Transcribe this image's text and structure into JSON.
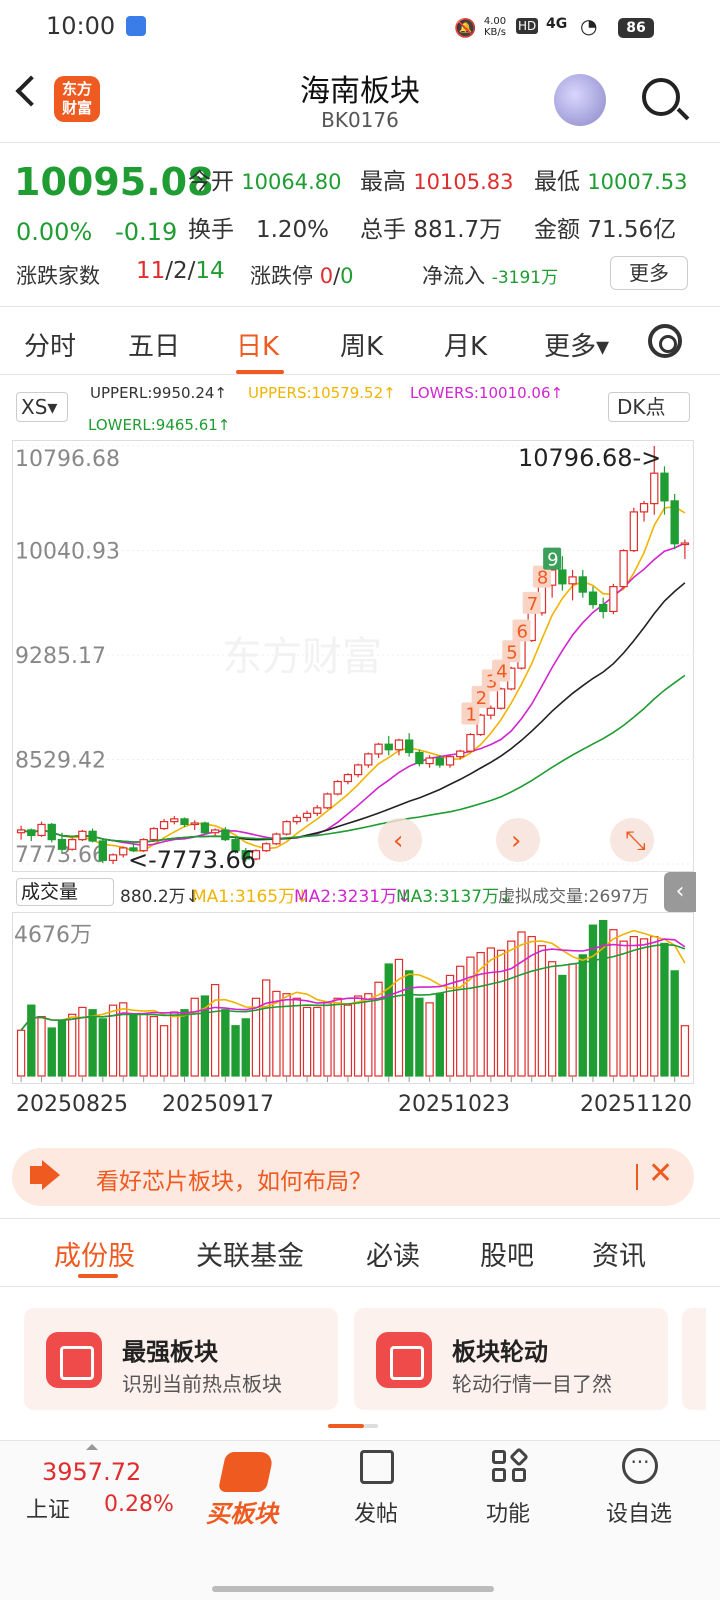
{
  "status_bar": {
    "time": "10:00",
    "net_speed": "4.00 KB/s",
    "signal": "4G",
    "battery": "86"
  },
  "header": {
    "title": "海南板块",
    "code": "BK0176",
    "logo_text": "东方财富"
  },
  "quote": {
    "price": "10095.08",
    "change_pct": "0.00%",
    "change": "-0.19",
    "open_label": "今开",
    "open": "10064.80",
    "high_label": "最高",
    "high": "10105.83",
    "low_label": "最低",
    "low": "10007.53",
    "turnover_label": "换手",
    "turnover": "1.20%",
    "volume_label": "总手",
    "volume": "881.7万",
    "amount_label": "金额",
    "amount": "71.56亿",
    "breadth_label": "涨跌家数",
    "breadth_up": "11",
    "breadth_flat": "/2/",
    "breadth_down": "14",
    "limit_label": "涨跌停",
    "limit_up": "0",
    "limit_sep": "/",
    "limit_down": "0",
    "netflow_label": "净流入",
    "netflow": "-3191万",
    "more": "更多"
  },
  "period_tabs": [
    "分时",
    "五日",
    "日K",
    "周K",
    "月K",
    "更多▾"
  ],
  "active_period": "日K",
  "indicators": {
    "selector": "XS▾",
    "upperl": "UPPERL:9950.24↑",
    "uppers": "UPPERS:10579.52↑",
    "lowers": "LOWERS:10010.06↑",
    "lowerl": "LOWERL:9465.61↑",
    "dk_button": "DK点"
  },
  "colors": {
    "up": "#e02d2d",
    "down": "#1f9c32",
    "accent": "#ef5a20",
    "ma1": "#f0b400",
    "ma2": "#d025d0",
    "ma3": "#1f9c32"
  },
  "chart_data": [
    {
      "type": "candlestick",
      "y_axis_labels": [
        "10796.68",
        "10040.93",
        "9285.17",
        "8529.42",
        "7773.66"
      ],
      "ylim": [
        7773.66,
        10796.68
      ],
      "max_annotation": "10796.68->",
      "min_annotation": "<-7773.66",
      "watermark": "东方财富",
      "x_tick_labels": [
        "20250825",
        "20250917",
        "20251023",
        "20251120"
      ],
      "candles": [
        [
          8000,
          8050,
          7950,
          8020
        ],
        [
          8020,
          8030,
          7940,
          7980
        ],
        [
          7980,
          8080,
          7970,
          8060
        ],
        [
          8060,
          8070,
          7930,
          7950
        ],
        [
          7950,
          8000,
          7850,
          7880
        ],
        [
          7880,
          7960,
          7870,
          7950
        ],
        [
          7950,
          8020,
          7940,
          8010
        ],
        [
          8010,
          8030,
          7930,
          7940
        ],
        [
          7940,
          7960,
          7780,
          7800
        ],
        [
          7800,
          7850,
          7774,
          7840
        ],
        [
          7840,
          7900,
          7820,
          7890
        ],
        [
          7890,
          7920,
          7860,
          7870
        ],
        [
          7870,
          7960,
          7860,
          7950
        ],
        [
          7950,
          8040,
          7940,
          8030
        ],
        [
          8030,
          8100,
          8020,
          8080
        ],
        [
          8080,
          8120,
          8060,
          8100
        ],
        [
          8100,
          8110,
          8040,
          8060
        ],
        [
          8060,
          8090,
          8020,
          8070
        ],
        [
          8070,
          8080,
          7990,
          8000
        ],
        [
          8000,
          8030,
          7980,
          8020
        ],
        [
          8020,
          8040,
          7940,
          7950
        ],
        [
          7950,
          7960,
          7850,
          7870
        ],
        [
          7870,
          7890,
          7790,
          7810
        ],
        [
          7810,
          7880,
          7800,
          7870
        ],
        [
          7870,
          7930,
          7860,
          7920
        ],
        [
          7920,
          8000,
          7910,
          7990
        ],
        [
          7990,
          8090,
          7980,
          8080
        ],
        [
          8080,
          8130,
          8060,
          8110
        ],
        [
          8110,
          8160,
          8080,
          8140
        ],
        [
          8140,
          8200,
          8120,
          8180
        ],
        [
          8180,
          8290,
          8170,
          8280
        ],
        [
          8280,
          8380,
          8270,
          8370
        ],
        [
          8370,
          8430,
          8350,
          8420
        ],
        [
          8420,
          8500,
          8400,
          8490
        ],
        [
          8490,
          8580,
          8470,
          8570
        ],
        [
          8570,
          8650,
          8540,
          8640
        ],
        [
          8640,
          8700,
          8560,
          8600
        ],
        [
          8600,
          8680,
          8560,
          8670
        ],
        [
          8670,
          8720,
          8550,
          8580
        ],
        [
          8580,
          8600,
          8480,
          8500
        ],
        [
          8500,
          8560,
          8470,
          8540
        ],
        [
          8540,
          8560,
          8470,
          8490
        ],
        [
          8490,
          8560,
          8470,
          8550
        ],
        [
          8550,
          8600,
          8530,
          8590
        ],
        [
          8590,
          8720,
          8580,
          8710
        ],
        [
          8710,
          8860,
          8700,
          8850
        ],
        [
          8850,
          8920,
          8820,
          8900
        ],
        [
          8900,
          9050,
          8890,
          9040
        ],
        [
          9040,
          9200,
          9030,
          9190
        ],
        [
          9190,
          9400,
          9180,
          9390
        ],
        [
          9390,
          9600,
          9380,
          9590
        ],
        [
          9590,
          9800,
          9570,
          9790
        ],
        [
          9790,
          9950,
          9700,
          9900
        ],
        [
          9900,
          10000,
          9750,
          9800
        ],
        [
          9800,
          9900,
          9680,
          9850
        ],
        [
          9850,
          9900,
          9700,
          9740
        ],
        [
          9740,
          9780,
          9620,
          9650
        ],
        [
          9650,
          9700,
          9550,
          9600
        ],
        [
          9600,
          9800,
          9580,
          9780
        ],
        [
          9780,
          10050,
          9770,
          10040
        ],
        [
          10040,
          10350,
          10030,
          10320
        ],
        [
          10320,
          10400,
          10250,
          10380
        ],
        [
          10380,
          10797,
          10300,
          10600
        ],
        [
          10600,
          10650,
          10300,
          10400
        ],
        [
          10400,
          10450,
          10050,
          10090
        ],
        [
          10090,
          10120,
          9980,
          10095
        ]
      ],
      "nine_turn_labels": [
        "1",
        "2",
        "3",
        "4",
        "5",
        "6",
        "7",
        "8",
        "9"
      ]
    },
    {
      "type": "bar",
      "title": "成交量",
      "y_axis_labels": [
        "4676万"
      ],
      "legend": [
        "880.2万↓",
        "MA1:3165万↓",
        "MA2:3231万↓",
        "MA3:3137万↓",
        "虚拟成交量:2697万"
      ],
      "values": [
        2000,
        3100,
        2600,
        2100,
        2400,
        2700,
        3000,
        2900,
        2500,
        3100,
        3200,
        2700,
        2700,
        2600,
        2200,
        2800,
        2900,
        3400,
        3500,
        4000,
        2900,
        2200,
        2500,
        3400,
        4200,
        3700,
        3600,
        3400,
        3000,
        3000,
        3200,
        3400,
        3100,
        3500,
        3600,
        4100,
        4900,
        5100,
        4600,
        3400,
        3200,
        3600,
        4400,
        4800,
        5200,
        5400,
        5600,
        5500,
        5900,
        6300,
        6100,
        5700,
        5000,
        4400,
        4900,
        5300,
        6600,
        6800,
        6400,
        5900,
        6100,
        6000,
        6100,
        5800,
        4600,
        2200
      ],
      "ylim": [
        0,
        7000
      ]
    }
  ],
  "banner": {
    "text": "看好芯片板块，如何布局？",
    "close": "✕"
  },
  "section_tabs": [
    "成份股",
    "关联基金",
    "必读",
    "股吧",
    "资讯"
  ],
  "cards": [
    {
      "title": "最强板块",
      "desc": "识别当前热点板块"
    },
    {
      "title": "板块轮动",
      "desc": "轮动行情一目了然"
    }
  ],
  "bottom_bar": {
    "index_value": "3957.72",
    "index_name": "上证",
    "index_change": "0.28%",
    "buy_label": "买板块",
    "post_label": "发帖",
    "func_label": "功能",
    "watch_label": "设自选"
  }
}
